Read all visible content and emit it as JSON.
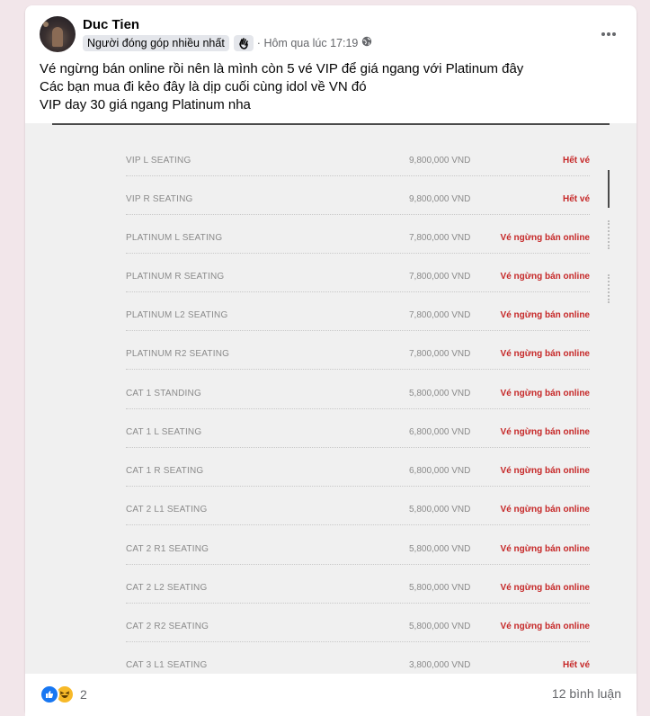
{
  "post": {
    "author": "Duc Tien",
    "badge": "Người đóng góp nhiều nhất",
    "timestamp": "Hôm qua lúc 17:19",
    "separator": "·",
    "lines": [
      "Vé ngừng bán online rồi nên là mình còn 5 vé VIP để giá ngang với Platinum đây",
      "Các bạn mua đi kẻo đây là dịp cuối cùng idol về VN đó",
      "VIP day 30 giá ngang Platinum nha"
    ]
  },
  "ticket_table": {
    "rows": [
      {
        "name": "VIP L SEATING",
        "price": "9,800,000 VND",
        "status": "Hết vé"
      },
      {
        "name": "VIP R SEATING",
        "price": "9,800,000 VND",
        "status": "Hết vé"
      },
      {
        "name": "PLATINUM L SEATING",
        "price": "7,800,000 VND",
        "status": "Vé ngừng bán online"
      },
      {
        "name": "PLATINUM R SEATING",
        "price": "7,800,000 VND",
        "status": "Vé ngừng bán online"
      },
      {
        "name": "PLATINUM L2 SEATING",
        "price": "7,800,000 VND",
        "status": "Vé ngừng bán online"
      },
      {
        "name": "PLATINUM R2 SEATING",
        "price": "7,800,000 VND",
        "status": "Vé ngừng bán online"
      },
      {
        "name": "CAT 1 STANDING",
        "price": "5,800,000 VND",
        "status": "Vé ngừng bán online"
      },
      {
        "name": "CAT 1 L SEATING",
        "price": "6,800,000 VND",
        "status": "Vé ngừng bán online"
      },
      {
        "name": "CAT 1 R SEATING",
        "price": "6,800,000 VND",
        "status": "Vé ngừng bán online"
      },
      {
        "name": "CAT 2 L1 SEATING",
        "price": "5,800,000 VND",
        "status": "Vé ngừng bán online"
      },
      {
        "name": "CAT 2 R1 SEATING",
        "price": "5,800,000 VND",
        "status": "Vé ngừng bán online"
      },
      {
        "name": "CAT 2 L2 SEATING",
        "price": "5,800,000 VND",
        "status": "Vé ngừng bán online"
      },
      {
        "name": "CAT 2 R2 SEATING",
        "price": "5,800,000 VND",
        "status": "Vé ngừng bán online"
      },
      {
        "name": "CAT 3 L1 SEATING",
        "price": "3,800,000 VND",
        "status": "Hết vé"
      }
    ]
  },
  "footer": {
    "reaction_count": "2",
    "comments": "12 bình luận",
    "reaction_icons": [
      "like-icon",
      "haha-icon"
    ]
  },
  "icons": {
    "badge_icon": "wave-hand-icon",
    "privacy_icon": "globe-icon",
    "menu_icon": "more-options-icon"
  },
  "colors": {
    "status_red": "#c62828",
    "like_blue": "#1877f2",
    "haha_yellow": "#f7b928"
  }
}
